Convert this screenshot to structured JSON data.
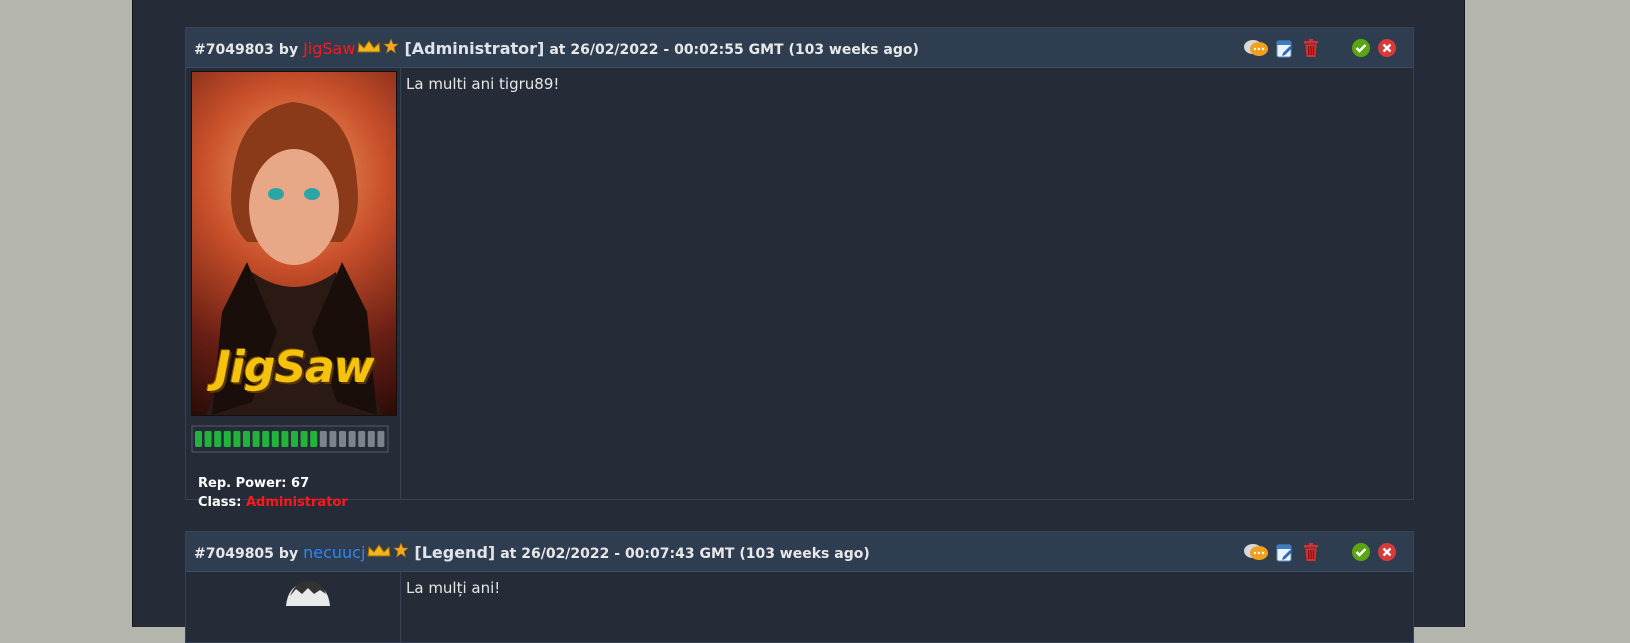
{
  "posts": [
    {
      "id": "#7049803",
      "by": "by",
      "user": "JigSaw",
      "rank": "[Administrator]",
      "meta": "at 26/02/2022 - 00:02:55 GMT (103 weeks ago)",
      "message": "La multi ani tigru89!",
      "avatar_text": "JigSaw",
      "rep_power_label": "Rep. Power: 67",
      "class_label": "Class:",
      "class_value": "Administrator",
      "reputation_fraction": 0.65,
      "user_color": "#ff1818"
    },
    {
      "id": "#7049805",
      "by": "by",
      "user": "necuucj",
      "rank": "[Legend]",
      "meta": "at 26/02/2022 - 00:07:43 GMT (103 weeks ago)",
      "message": "La mulți ani!",
      "user_color": "#2f86f5"
    }
  ],
  "icons": [
    "quote-icon",
    "edit-icon",
    "delete-icon",
    "approve-icon",
    "reject-icon",
    "crown-icon",
    "star-icon"
  ],
  "colors": {
    "panel_bg": "#252c38",
    "header_bg": "#2f3d50",
    "page_bg": "#b4b5ad",
    "rep_green": "#22b43a"
  }
}
